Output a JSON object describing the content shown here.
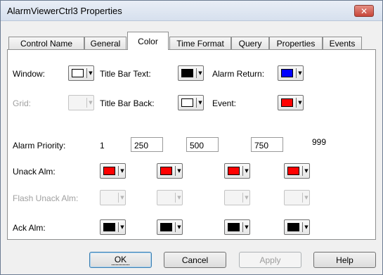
{
  "window": {
    "title": "AlarmViewerCtrl3 Properties",
    "close_glyph": "✕"
  },
  "tabs": [
    {
      "label": "Control Name"
    },
    {
      "label": "General"
    },
    {
      "label": "Color"
    },
    {
      "label": "Time Format"
    },
    {
      "label": "Query"
    },
    {
      "label": "Properties"
    },
    {
      "label": "Events"
    }
  ],
  "active_tab": "Color",
  "color_panel": {
    "window_label": "Window:",
    "grid_label": "Grid:",
    "title_bar_text_label": "Title Bar Text:",
    "title_bar_back_label": "Title Bar Back:",
    "alarm_return_label": "Alarm Return:",
    "event_label": "Event:",
    "colors": {
      "window": "#ffffff",
      "grid": "#f4f4f4",
      "title_bar_text": "#000000",
      "title_bar_back": "#ffffff",
      "alarm_return": "#0000ff",
      "event": "#ff0000"
    },
    "priority_label": "Alarm Priority:",
    "priority_start": "1",
    "priority_values": [
      "250",
      "500",
      "750"
    ],
    "priority_end": "999",
    "unack_label": "Unack Alm:",
    "flash_unack_label": "Flash Unack Alm:",
    "ack_label": "Ack Alm:",
    "unack_colors": [
      "#ff0000",
      "#ff0000",
      "#ff0000",
      "#ff0000"
    ],
    "flash_unack_colors": [
      "#f4f4f4",
      "#f4f4f4",
      "#f4f4f4",
      "#f4f4f4"
    ],
    "ack_colors": [
      "#000000",
      "#000000",
      "#000000",
      "#000000"
    ],
    "dropdown_arrow": "▼"
  },
  "buttons": {
    "ok": "OK",
    "cancel": "Cancel",
    "apply": "Apply",
    "help": "Help"
  }
}
